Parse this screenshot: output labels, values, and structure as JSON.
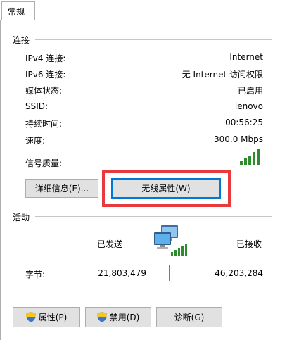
{
  "tab": {
    "label": "常规"
  },
  "connection": {
    "title": "连接",
    "rows": [
      {
        "label": "IPv4 连接:",
        "value": "Internet"
      },
      {
        "label": "IPv6 连接:",
        "value": "无 Internet 访问权限"
      },
      {
        "label": "媒体状态:",
        "value": "已启用"
      },
      {
        "label": "SSID:",
        "value": "lenovo"
      },
      {
        "label": "持续时间:",
        "value": "00:56:25"
      },
      {
        "label": "速度:",
        "value": "300.0 Mbps"
      }
    ],
    "signal_label": "信号质量:",
    "signal_bars": 5,
    "details_button": "详细信息(E)...",
    "wireless_props_button": "无线属性(W)"
  },
  "activity": {
    "title": "活动",
    "sent_label": "已发送",
    "received_label": "已接收",
    "bytes_label": "字节:",
    "bytes_sent": "21,803,479",
    "bytes_received": "46,203,284"
  },
  "actions": {
    "properties_button": "属性(P)",
    "disable_button": "禁用(D)",
    "diagnose_button": "诊断(G)"
  },
  "colors": {
    "highlight": "#e8393c",
    "signal": "#2e8b2e",
    "focus": "#0078d7"
  }
}
